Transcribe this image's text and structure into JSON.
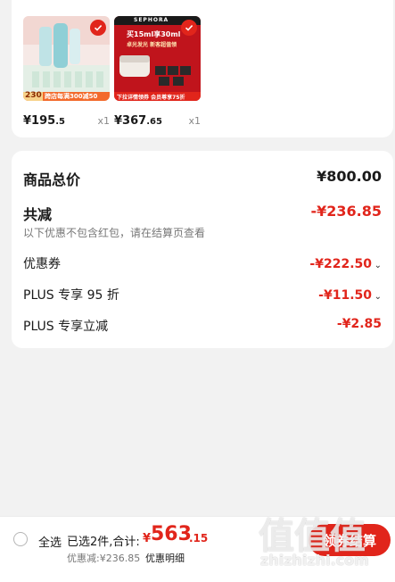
{
  "products": [
    {
      "name": "product-1",
      "price_int": "¥195",
      "price_dec": ".5",
      "qty": "x1",
      "banner_number": "230",
      "banner_text": "跨店每满300减50"
    },
    {
      "name": "product-2",
      "brand_text": "SEPHORA",
      "promo_line1": "买15ml享30ml",
      "promo_line2": "卓光发光 新客超值领",
      "price_int": "¥367",
      "price_dec": ".65",
      "qty": "x1",
      "banner_text": "下拉详情领券 会员尊享75折"
    }
  ],
  "summary": {
    "total_label": "商品总价",
    "total_value": "¥800.00",
    "discount_label": "共减",
    "discount_value": "-¥236.85",
    "note": "以下优惠不包含红包，请在结算页查看",
    "items": [
      {
        "label": "优惠券",
        "value": "-¥222.50",
        "chevron": "chevron-down-icon"
      },
      {
        "label": "PLUS 专享 95 折",
        "value": "-¥11.50",
        "chevron": "chevron-down-icon"
      },
      {
        "label": "PLUS 专享立减",
        "value": "-¥2.85"
      }
    ]
  },
  "bottom_bar": {
    "select_all": "全选",
    "selected_count": "已选2件,合计:",
    "total_symbol": "¥",
    "total_int": "563",
    "total_dec": ".15",
    "discount_text": "优惠减:¥236.85",
    "detail_link": "优惠明细",
    "checkout": "领券结算"
  },
  "watermark": {
    "big": "值值值",
    "small": "zhizhizhi.com"
  },
  "colors": {
    "accent": "#e1251b",
    "background": "#f2f2f2"
  }
}
